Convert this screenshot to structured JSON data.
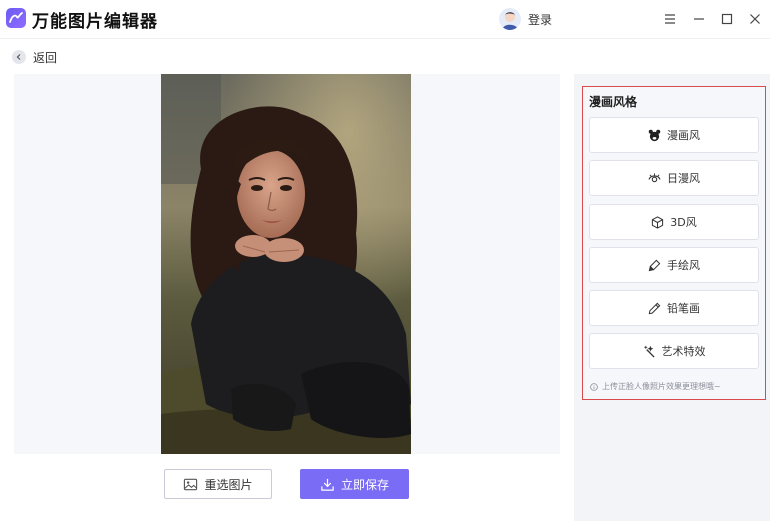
{
  "app": {
    "title": "万能图片编辑器",
    "login_label": "登录"
  },
  "nav": {
    "back_label": "返回"
  },
  "actions": {
    "reselect_label": "重选图片",
    "save_label": "立即保存"
  },
  "panel": {
    "title": "漫画风格",
    "styles": [
      {
        "label": "漫画风",
        "icon": "bear-icon"
      },
      {
        "label": "日漫风",
        "icon": "eye-icon"
      },
      {
        "label": "3D风",
        "icon": "cube-icon"
      },
      {
        "label": "手绘风",
        "icon": "marker-icon"
      },
      {
        "label": "铅笔画",
        "icon": "pencil-icon"
      },
      {
        "label": "艺术特效",
        "icon": "magic-wand-icon"
      }
    ],
    "tip": "上传正脸人像照片效果更理想哦~"
  },
  "colors": {
    "accent": "#7b6cf5",
    "highlight_border": "#d94a4a"
  }
}
